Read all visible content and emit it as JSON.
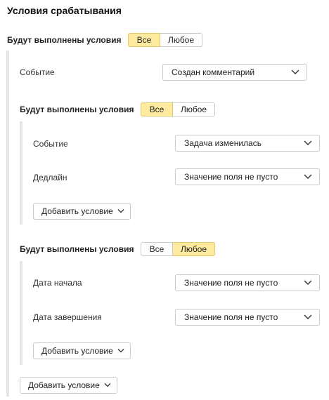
{
  "title": "Условия срабатывания",
  "root_group": {
    "label": "Будут выполнены условия",
    "options": [
      "Все",
      "Любое"
    ],
    "selected": "Все",
    "condition": {
      "label": "Событие",
      "value": "Создан комментарий"
    },
    "add_button": "Добавить условие"
  },
  "group_a": {
    "label": "Будут выполнены условия",
    "options": [
      "Все",
      "Любое"
    ],
    "selected": "Все",
    "conditions": [
      {
        "label": "Событие",
        "value": "Задача изменилась"
      },
      {
        "label": "Дедлайн",
        "value": "Значение поля не пусто"
      }
    ],
    "add_button": "Добавить условие"
  },
  "group_b": {
    "label": "Будут выполнены условия",
    "options": [
      "Все",
      "Любое"
    ],
    "selected": "Любое",
    "conditions": [
      {
        "label": "Дата начала",
        "value": "Значение поля не пусто"
      },
      {
        "label": "Дата завершения",
        "value": "Значение поля не пусто"
      }
    ],
    "add_button": "Добавить условие"
  },
  "icons": {
    "dropdown": "chevron-down-icon"
  },
  "colors": {
    "active_toggle": "#ffeba0",
    "active_border": "#e3c96b",
    "group_bar": "#e5e5e5"
  }
}
